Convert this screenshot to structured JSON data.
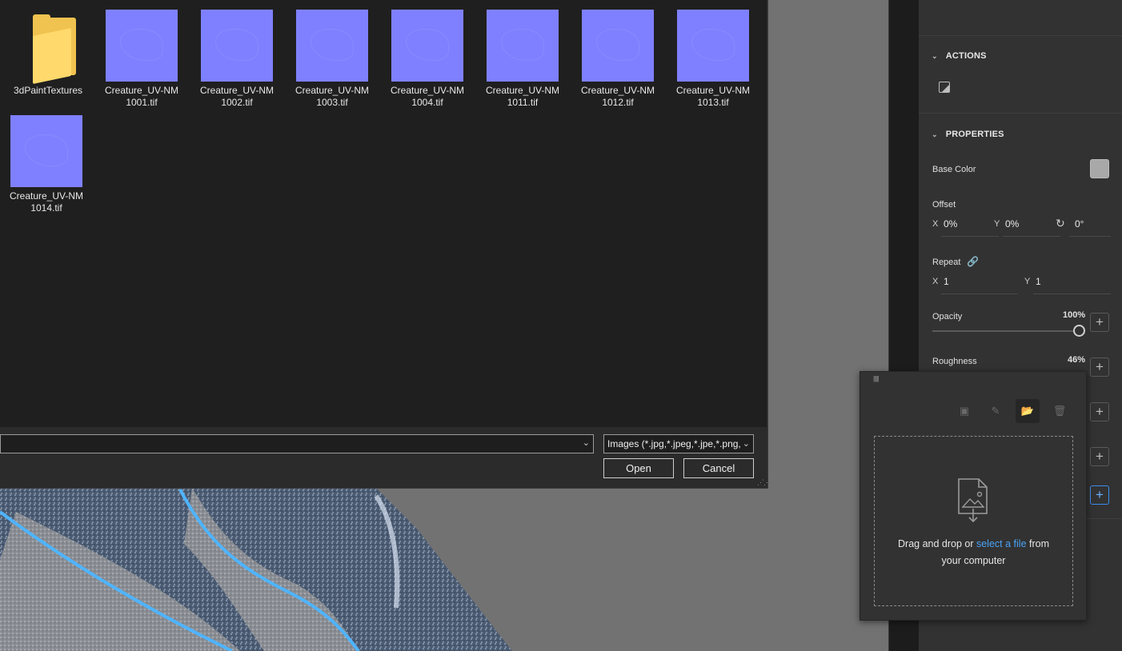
{
  "dialog": {
    "folder": {
      "name": "3dPaintTextures",
      "icon": "folder-icon"
    },
    "files": [
      {
        "line1": "Creature_UV-NM",
        "line2": "1001.tif"
      },
      {
        "line1": "Creature_UV-NM",
        "line2": "1002.tif"
      },
      {
        "line1": "Creature_UV-NM",
        "line2": "1003.tif"
      },
      {
        "line1": "Creature_UV-NM",
        "line2": "1004.tif"
      },
      {
        "line1": "Creature_UV-NM",
        "line2": "1011.tif"
      },
      {
        "line1": "Creature_UV-NM",
        "line2": "1012.tif"
      },
      {
        "line1": "Creature_UV-NM",
        "line2": "1013.tif"
      },
      {
        "line1": "Creature_UV-NM",
        "line2": "1014.tif"
      }
    ],
    "filename_value": "",
    "file_type_filter": "Images (*.jpg,*.jpeg,*.jpe,*.png,",
    "open_label": "Open",
    "cancel_label": "Cancel"
  },
  "panel": {
    "actions": {
      "title": "ACTIONS",
      "icon": "image-action-icon"
    },
    "properties": {
      "title": "PROPERTIES",
      "base_color": {
        "label": "Base Color",
        "color": "#a8a8a8"
      },
      "offset": {
        "label": "Offset",
        "x_axis": "X",
        "x": "0%",
        "y_axis": "Y",
        "y": "0%",
        "rotation": "0°",
        "rotation_icon": "rotate-icon"
      },
      "repeat": {
        "label": "Repeat",
        "link_icon": "link-icon",
        "x_axis": "X",
        "x": "1",
        "y_axis": "Y",
        "y": "1"
      },
      "opacity": {
        "label": "Opacity",
        "value": "100%",
        "level": 1.0
      },
      "roughness": {
        "label": "Roughness",
        "value": "46%",
        "level": 0.46
      }
    }
  },
  "popover": {
    "icons": [
      "import-icon",
      "edit-icon",
      "open-folder-icon",
      "delete-icon"
    ],
    "upload_icon": "image-file-upload-icon",
    "drop_text_before": "Drag and drop or ",
    "drop_link": "select a file",
    "drop_text_after": " from",
    "drop_text_line2": "your computer"
  },
  "colors": {
    "accent": "#4ba3f5",
    "normal_map": "#7f80ff",
    "folder": "#f0c24f"
  }
}
